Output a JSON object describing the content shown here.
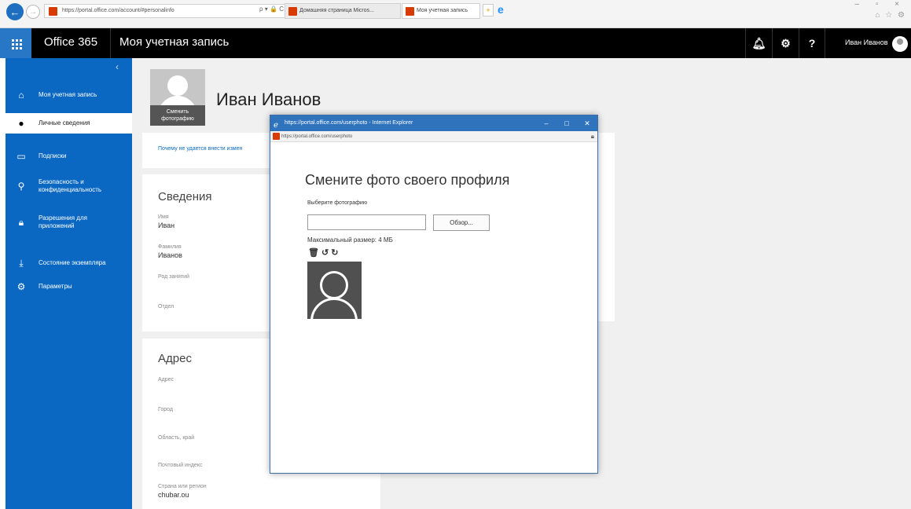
{
  "browser": {
    "url": "https://portal.office.com/account/#personalinfo",
    "address_tools": "ρ ▾ 🔒 C",
    "tabs": [
      {
        "label": "Домашняя страница Micros..."
      },
      {
        "label": "Моя учетная запись"
      }
    ],
    "window_controls": "– ▫ ×",
    "fav_icons": "⌂ ☆ ⚙"
  },
  "header": {
    "brand": "Office 365",
    "title": "Моя учетная запись",
    "user_name": "Иван Иванов",
    "icons": {
      "bell": "bell-icon",
      "gear": "gear-icon",
      "help": "help-icon"
    }
  },
  "sidebar": {
    "collapse_glyph": "‹",
    "items": [
      {
        "label": "Моя учетная запись",
        "icon": "home-icon"
      },
      {
        "label": "Личные сведения",
        "icon": "person-icon"
      },
      {
        "label": "Подписки",
        "icon": "card-icon"
      },
      {
        "label": "Безопасность и конфиденциальность",
        "icon": "key-icon"
      },
      {
        "label": "Разрешения для приложений",
        "icon": "lock-icon"
      },
      {
        "label": "Состояние экземпляра",
        "icon": "download-icon"
      },
      {
        "label": "Параметры",
        "icon": "gear-icon"
      }
    ]
  },
  "profile": {
    "name": "Иван Иванов",
    "change_photo": "Сменить фотографию",
    "why_link": "Почему не удается внести измен"
  },
  "info_card": {
    "title": "Сведения",
    "fields": [
      {
        "label": "Имя",
        "value": "Иван"
      },
      {
        "label": "Фамилия",
        "value": "Иванов"
      },
      {
        "label": "Род занятий",
        "value": ""
      },
      {
        "label": "Отдел",
        "value": ""
      }
    ]
  },
  "address_card": {
    "title": "Адрес",
    "fields": [
      {
        "label": "Адрес",
        "value": ""
      },
      {
        "label": "Город",
        "value": ""
      },
      {
        "label": "Область, край",
        "value": ""
      },
      {
        "label": "Почтовый индекс",
        "value": ""
      },
      {
        "label": "Страна или регион",
        "value": "chubar.ou"
      }
    ]
  },
  "popup": {
    "window_title": "https://portal.office.com/userphoto - Internet Explorer",
    "url": "https://portal.office.com/userphoto",
    "controls": {
      "minimize": "–",
      "maximize": "□",
      "close": "✕"
    },
    "heading": "Смените фото своего профиля",
    "choose_label": "Выберите фотографию",
    "file_value": "",
    "browse_label": "Обзор...",
    "max_size": "Максимальный размер: 4 МБ",
    "tools": {
      "delete": "🗑",
      "rotate_left": "↺",
      "rotate_right": "↻"
    }
  },
  "colors": {
    "sidebar": "#0a68c3",
    "header": "#000000",
    "waffle": "#2877c6",
    "popup_titlebar": "#2f73bd"
  }
}
